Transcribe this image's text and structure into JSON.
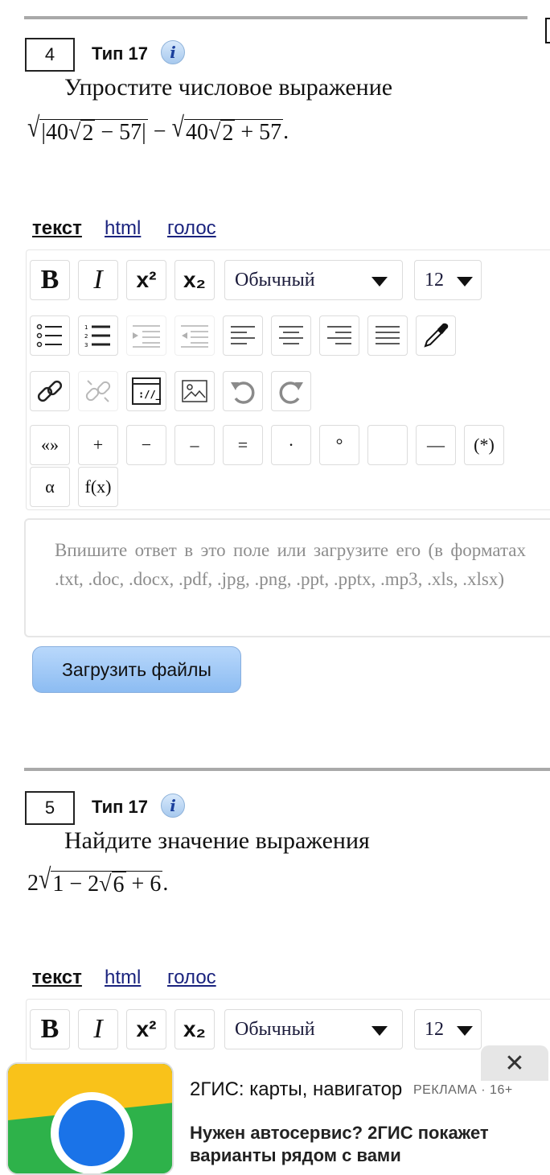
{
  "problems": [
    {
      "number": "4",
      "type_label": "Тип 17",
      "info_icon": "i",
      "question": "Упростите числовое выражение",
      "math": {
        "a": "40",
        "b": "2",
        "c": "57",
        "op_minus": "−",
        "op_plus": "+",
        "bar": "|",
        "end": "."
      }
    },
    {
      "number": "5",
      "type_label": "Тип 17",
      "info_icon": "i",
      "question": "Найдите значение выражения",
      "math": {
        "coef": "2",
        "one": "1",
        "two": "2",
        "six": "6",
        "op_minus": "−",
        "op_plus": "+",
        "end": "."
      }
    }
  ],
  "tabs": {
    "text": "текст",
    "html": "html",
    "voice": "голос"
  },
  "toolbar": {
    "bold": "B",
    "italic": "I",
    "sup": "x²",
    "sub": "x₂",
    "style_value": "Обычный",
    "size_value": "12",
    "chars": [
      "«»",
      "+",
      "−",
      "–",
      "=",
      "·",
      "°",
      "",
      "—",
      "(*)"
    ],
    "chars2": [
      "α",
      "f(x)"
    ]
  },
  "answer": {
    "placeholder": "Впишите ответ в это поле или загрузите его (в форматах .txt, .doc, .docx, .pdf, .jpg, .png, .ppt, .pptx, .mp3, .xls, .xlsx)"
  },
  "upload_label": "Загрузить файлы",
  "ad": {
    "title": "2ГИС: карты, навигатор",
    "label": "РЕКЛАМА · 16+",
    "text": "Нужен автосервис? 2ГИС покажет варианты рядом с вами",
    "close": "✕"
  },
  "colors": {
    "accent": "#8cbcf2",
    "link": "#1a237e",
    "ad_green": "#2eb24a",
    "ad_yellow": "#f9c21a",
    "ad_blue": "#1a73e8"
  }
}
